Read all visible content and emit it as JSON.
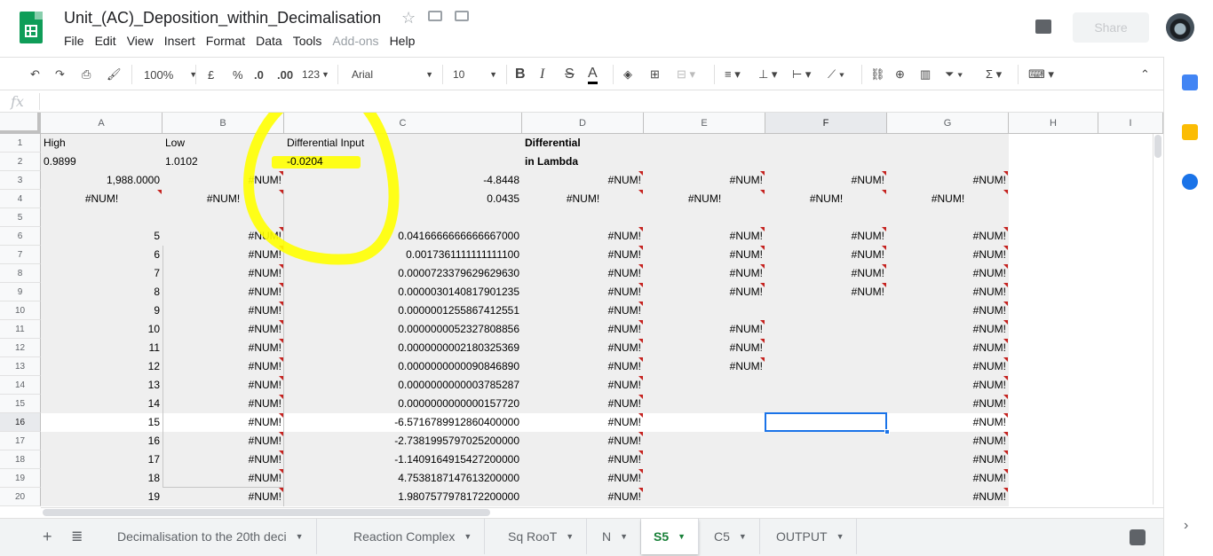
{
  "app": {
    "doc_title": "Unit_(AC)_Deposition_within_Decimalisation",
    "share_label": "Share",
    "menu": [
      "File",
      "Edit",
      "View",
      "Insert",
      "Format",
      "Data",
      "Tools",
      "Add-ons",
      "Help"
    ],
    "disabled_menu": [
      "Add-ons"
    ]
  },
  "toolbar": {
    "zoom": "100%",
    "currency": "£",
    "percent": "%",
    "dec_decrease": ".0",
    "dec_increase": ".00",
    "more_formats": "123",
    "font": "Arial",
    "font_size": "10",
    "bold": "B",
    "italic": "I",
    "strike": "S",
    "text_color": "A",
    "text_color_value": "#000000"
  },
  "formula_bar": {
    "fx": "fx",
    "value": ""
  },
  "columns": [
    "A",
    "B",
    "C",
    "D",
    "E",
    "F",
    "G",
    "H",
    "I"
  ],
  "selected_column": "F",
  "selected_row": "16",
  "rows": [
    "1",
    "2",
    "3",
    "4",
    "5",
    "6",
    "7",
    "8",
    "9",
    "10",
    "11",
    "12",
    "13",
    "14",
    "15",
    "16",
    "17",
    "18",
    "19",
    "20"
  ],
  "cells": {
    "A1": "High",
    "B1": "Low",
    "C1": "Differential Input",
    "D1": "Differential",
    "A2": "0.9899",
    "B2": "1.0102",
    "C2": "-0.0204",
    "D2": "in Lambda",
    "A3": "1,988.0000",
    "B3": "#NUM!",
    "C3": "-4.8448",
    "D3": "#NUM!",
    "E3": "#NUM!",
    "F3": "#NUM!",
    "G3": "#NUM!",
    "A4": "#NUM!",
    "B4": "#NUM!",
    "C4": "0.0435",
    "D4": "#NUM!",
    "E4": "#NUM!",
    "F4": "#NUM!",
    "G4": "#NUM!",
    "A6": "5",
    "B6": "#NUM!",
    "C6": "0.0416666666666667000",
    "D6": "#NUM!",
    "E6": "#NUM!",
    "F6": "#NUM!",
    "G6": "#NUM!",
    "A7": "6",
    "B7": "#NUM!",
    "C7": "0.0017361111111111100",
    "D7": "#NUM!",
    "E7": "#NUM!",
    "F7": "#NUM!",
    "G7": "#NUM!",
    "A8": "7",
    "B8": "#NUM!",
    "C8": "0.0000723379629629630",
    "D8": "#NUM!",
    "E8": "#NUM!",
    "F8": "#NUM!",
    "G8": "#NUM!",
    "A9": "8",
    "B9": "#NUM!",
    "C9": "0.0000030140817901235",
    "D9": "#NUM!",
    "E9": "#NUM!",
    "F9": "#NUM!",
    "G9": "#NUM!",
    "A10": "9",
    "B10": "#NUM!",
    "C10": "0.0000001255867412551",
    "D10": "#NUM!",
    "G10": "#NUM!",
    "A11": "10",
    "B11": "#NUM!",
    "C11": "0.0000000052327808856",
    "D11": "#NUM!",
    "E11": "#NUM!",
    "G11": "#NUM!",
    "A12": "11",
    "B12": "#NUM!",
    "C12": "0.0000000002180325369",
    "D12": "#NUM!",
    "E12": "#NUM!",
    "G12": "#NUM!",
    "A13": "12",
    "B13": "#NUM!",
    "C13": "0.0000000000090846890",
    "D13": "#NUM!",
    "E13": "#NUM!",
    "G13": "#NUM!",
    "A14": "13",
    "B14": "#NUM!",
    "C14": "0.0000000000003785287",
    "D14": "#NUM!",
    "G14": "#NUM!",
    "A15": "14",
    "B15": "#NUM!",
    "C15": "0.0000000000000157720",
    "D15": "#NUM!",
    "G15": "#NUM!",
    "A16": "15",
    "B16": "#NUM!",
    "C16": "-6.5716789912860400000",
    "D16": "#NUM!",
    "G16": "#NUM!",
    "A17": "16",
    "B17": "#NUM!",
    "C17": "-2.7381995797025200000",
    "D17": "#NUM!",
    "G17": "#NUM!",
    "A18": "17",
    "B18": "#NUM!",
    "C18": "-1.1409164915427200000",
    "D18": "#NUM!",
    "G18": "#NUM!",
    "A19": "18",
    "B19": "#NUM!",
    "C19": "4.7538187147613200000",
    "D19": "#NUM!",
    "G19": "#NUM!",
    "A20": "19",
    "B20": "#NUM!",
    "C20": "1.9807577978172200000",
    "D20": "#NUM!",
    "G20": "#NUM!"
  },
  "sheet_tabs": [
    "Decimalisation to the 20th deci",
    "Reaction Complex",
    "Sq RooT",
    "N",
    "S5",
    "C5",
    "OUTPUT"
  ],
  "active_tab": "S5",
  "colors": {
    "accent": "#1a73e8",
    "highlight": "#ffff00",
    "active_tab": "#188038",
    "error_flag": "#c5221f"
  }
}
